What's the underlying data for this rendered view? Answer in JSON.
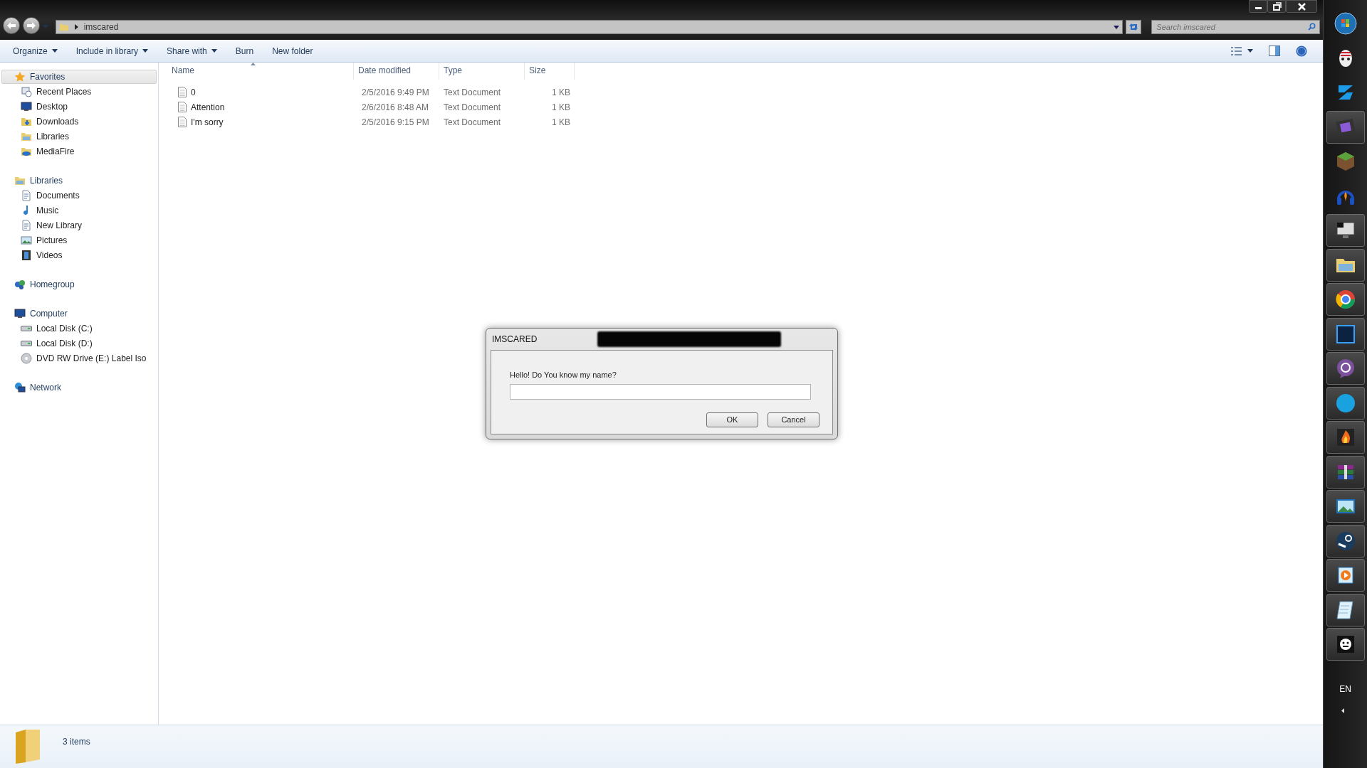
{
  "window": {
    "controls": [
      {
        "kind": "minimize"
      },
      {
        "kind": "restore"
      },
      {
        "kind": "close"
      }
    ]
  },
  "address_bar": {
    "path": "imscared"
  },
  "search": {
    "placeholder": "Search imscared"
  },
  "toolbar": {
    "items": [
      {
        "label": "Organize",
        "dropdown": true
      },
      {
        "label": "Include in library",
        "dropdown": true
      },
      {
        "label": "Share with",
        "dropdown": true
      },
      {
        "label": "Burn",
        "dropdown": false
      },
      {
        "label": "New folder",
        "dropdown": false
      }
    ]
  },
  "sidebar": {
    "groups": [
      {
        "label": "Favorites",
        "kind": "star",
        "selected": true,
        "children": [
          {
            "label": "Recent Places",
            "kind": "recent"
          },
          {
            "label": "Desktop",
            "kind": "monitor"
          },
          {
            "label": "Downloads",
            "kind": "download"
          },
          {
            "label": "Libraries",
            "kind": "folder"
          },
          {
            "label": "MediaFire",
            "kind": "cloud"
          }
        ]
      },
      {
        "label": "Libraries",
        "kind": "folder",
        "selected": false,
        "children": [
          {
            "label": "Documents",
            "kind": "doc"
          },
          {
            "label": "Music",
            "kind": "note"
          },
          {
            "label": "New Library",
            "kind": "doc"
          },
          {
            "label": "Pictures",
            "kind": "picture"
          },
          {
            "label": "Videos",
            "kind": "film"
          }
        ]
      },
      {
        "label": "Homegroup",
        "kind": "people",
        "selected": false
      },
      {
        "label": "Computer",
        "kind": "monitor",
        "selected": false,
        "children": [
          {
            "label": "Local Disk (C:)",
            "kind": "disk"
          },
          {
            "label": "Local Disk (D:)",
            "kind": "disk"
          },
          {
            "label": "DVD RW Drive (E:) Label Iso",
            "kind": "disc"
          }
        ]
      },
      {
        "label": "Network",
        "kind": "globe",
        "selected": false
      }
    ]
  },
  "table": {
    "columns": [
      {
        "label": "Name",
        "sorted": true
      },
      {
        "label": "Date modified",
        "sorted": false
      },
      {
        "label": "Type",
        "sorted": false
      },
      {
        "label": "Size",
        "sorted": false
      }
    ],
    "rows": [
      {
        "name": "0",
        "date": "2/5/2016 9:49 PM",
        "type": "Text Document",
        "size": "1 KB"
      },
      {
        "name": "Attention",
        "date": "2/6/2016 8:48 AM",
        "type": "Text Document",
        "size": "1 KB"
      },
      {
        "name": "I'm sorry",
        "date": "2/5/2016 9:15 PM",
        "type": "Text Document",
        "size": "1 KB"
      }
    ]
  },
  "status_bar": {
    "text": "3 items"
  },
  "dialog": {
    "title": "IMSCARED",
    "prompt": "Hello! Do You know my name?",
    "buttons": [
      "OK",
      "Cancel"
    ]
  },
  "taskbar": {
    "items": [
      {
        "kind": "orb",
        "running": false
      },
      {
        "kind": "mask",
        "running": false
      },
      {
        "kind": "zigzag",
        "running": false
      },
      {
        "kind": "film",
        "running": true
      },
      {
        "kind": "cube",
        "running": false
      },
      {
        "kind": "headphones",
        "running": false
      },
      {
        "kind": "monitor",
        "running": true
      },
      {
        "kind": "folder",
        "running": true
      },
      {
        "kind": "ring",
        "running": true
      },
      {
        "kind": "square",
        "running": true
      },
      {
        "kind": "bubble",
        "running": true
      },
      {
        "kind": "circle",
        "running": true
      },
      {
        "kind": "flame",
        "running": true
      },
      {
        "kind": "books",
        "running": true
      },
      {
        "kind": "picture",
        "running": true
      },
      {
        "kind": "steam",
        "running": true
      },
      {
        "kind": "play",
        "running": true
      },
      {
        "kind": "notepad",
        "running": true
      },
      {
        "kind": "smiley",
        "running": true
      }
    ],
    "language": "EN"
  }
}
